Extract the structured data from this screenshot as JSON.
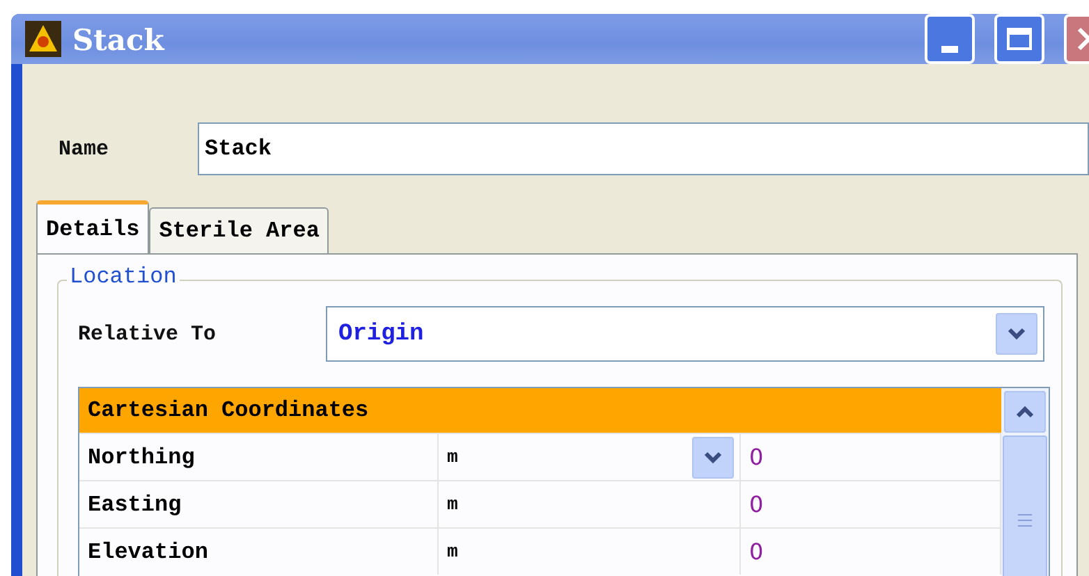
{
  "window": {
    "title": "Stack"
  },
  "name_field": {
    "label": "Name",
    "value": "Stack"
  },
  "tabs": [
    {
      "label": "Details",
      "selected": true
    },
    {
      "label": "Sterile Area",
      "selected": false
    }
  ],
  "location": {
    "legend": "Location",
    "relative_to_label": "Relative To",
    "relative_to_value": "Origin"
  },
  "grid": {
    "header": "Cartesian Coordinates",
    "rows": [
      {
        "name": "Northing",
        "unit": "m",
        "value": "0",
        "active": true
      },
      {
        "name": "Easting",
        "unit": "m",
        "value": "0",
        "active": false
      },
      {
        "name": "Elevation",
        "unit": "m",
        "value": "0",
        "active": false
      }
    ]
  }
}
